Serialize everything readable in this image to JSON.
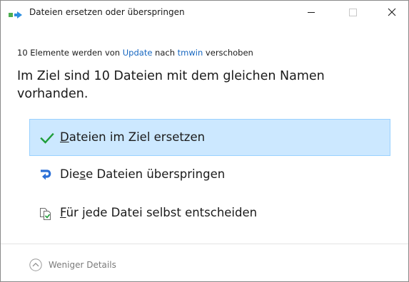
{
  "window": {
    "title": "Dateien ersetzen oder überspringen",
    "icon": "move-files-icon",
    "controls": {
      "minimize": "minimize-icon",
      "maximize": "maximize-icon",
      "close": "close-icon"
    }
  },
  "info": {
    "prefix": "10 Elemente werden von ",
    "source": "Update",
    "middle": " nach ",
    "destination": "tmwin",
    "suffix": " verschoben"
  },
  "headline": "Im Ziel sind 10 Dateien mit dem gleichen Namen vorhanden.",
  "options": [
    {
      "icon": "checkmark-icon",
      "before": "",
      "mnemonic": "D",
      "after": "ateien im Ziel ersetzen",
      "selected": true
    },
    {
      "icon": "skip-arrow-icon",
      "before": "Die",
      "mnemonic": "s",
      "after": "e Dateien überspringen",
      "selected": false
    },
    {
      "icon": "compare-files-icon",
      "before": "",
      "mnemonic": "F",
      "after": "ür jede Datei selbst entscheiden",
      "selected": false
    }
  ],
  "footer": {
    "details_label": "Weniger Details",
    "details_icon": "chevron-up-circle-icon"
  },
  "colors": {
    "accent_link": "#1566c0",
    "selected_bg": "#cce8ff",
    "selected_border": "#99d1ff",
    "check_green": "#1f9e3a",
    "skip_blue": "#2b6fd6"
  }
}
